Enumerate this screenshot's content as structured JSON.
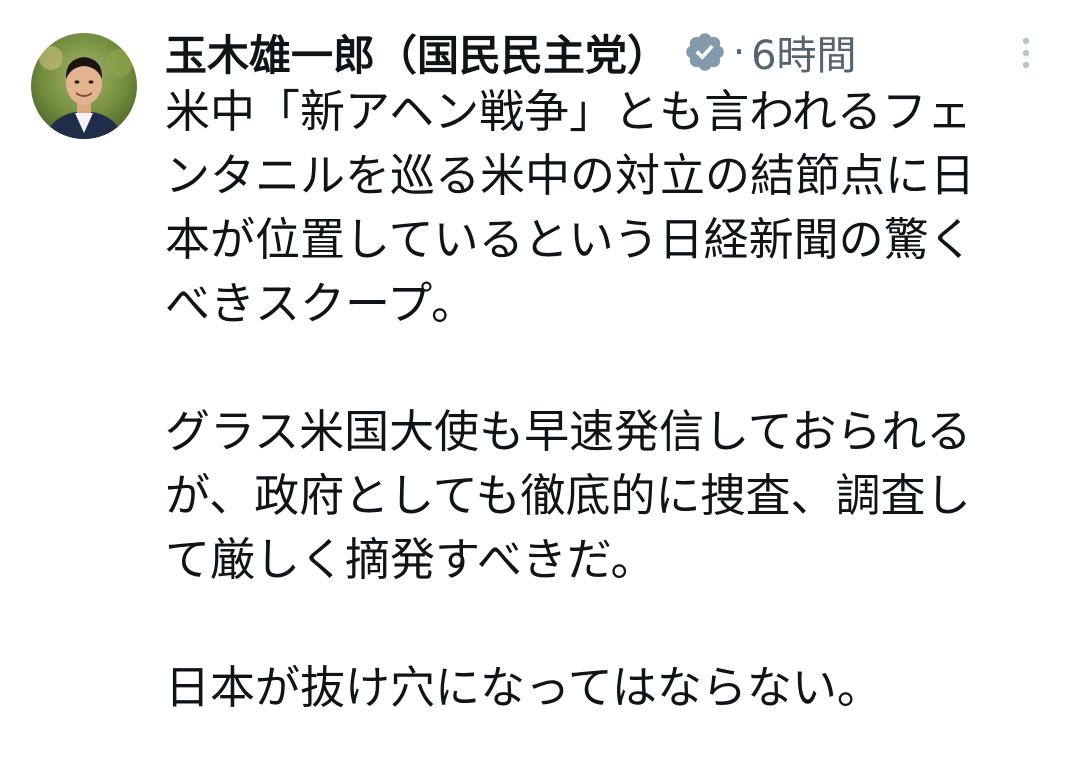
{
  "author": {
    "name": "玉木雄一郎（国民民主党）",
    "verified": true,
    "avatar_icon": "profile-photo"
  },
  "meta": {
    "separator": "·",
    "time": "6時間",
    "more_icon": "more-vertical-icon"
  },
  "tweet": {
    "paragraphs": [
      {
        "lines": [
          "米中「新アヘン戦争」とも言われるフェ",
          "ンタニルを巡る米中の対立の結節点に日",
          "本が位置しているという日経新聞の驚く",
          "べきスクープ。"
        ]
      },
      {
        "lines": [
          "グラス米国大使も早速発信しておられる",
          "が、政府としても徹底的に捜査、調査し",
          "て厳しく摘発すべきだ。"
        ]
      },
      {
        "lines": [
          "日本が抜け穴になってはならない。"
        ]
      }
    ]
  },
  "colors": {
    "text": "#0f1419",
    "secondary": "#536471",
    "verified_badge": "#829aab"
  }
}
